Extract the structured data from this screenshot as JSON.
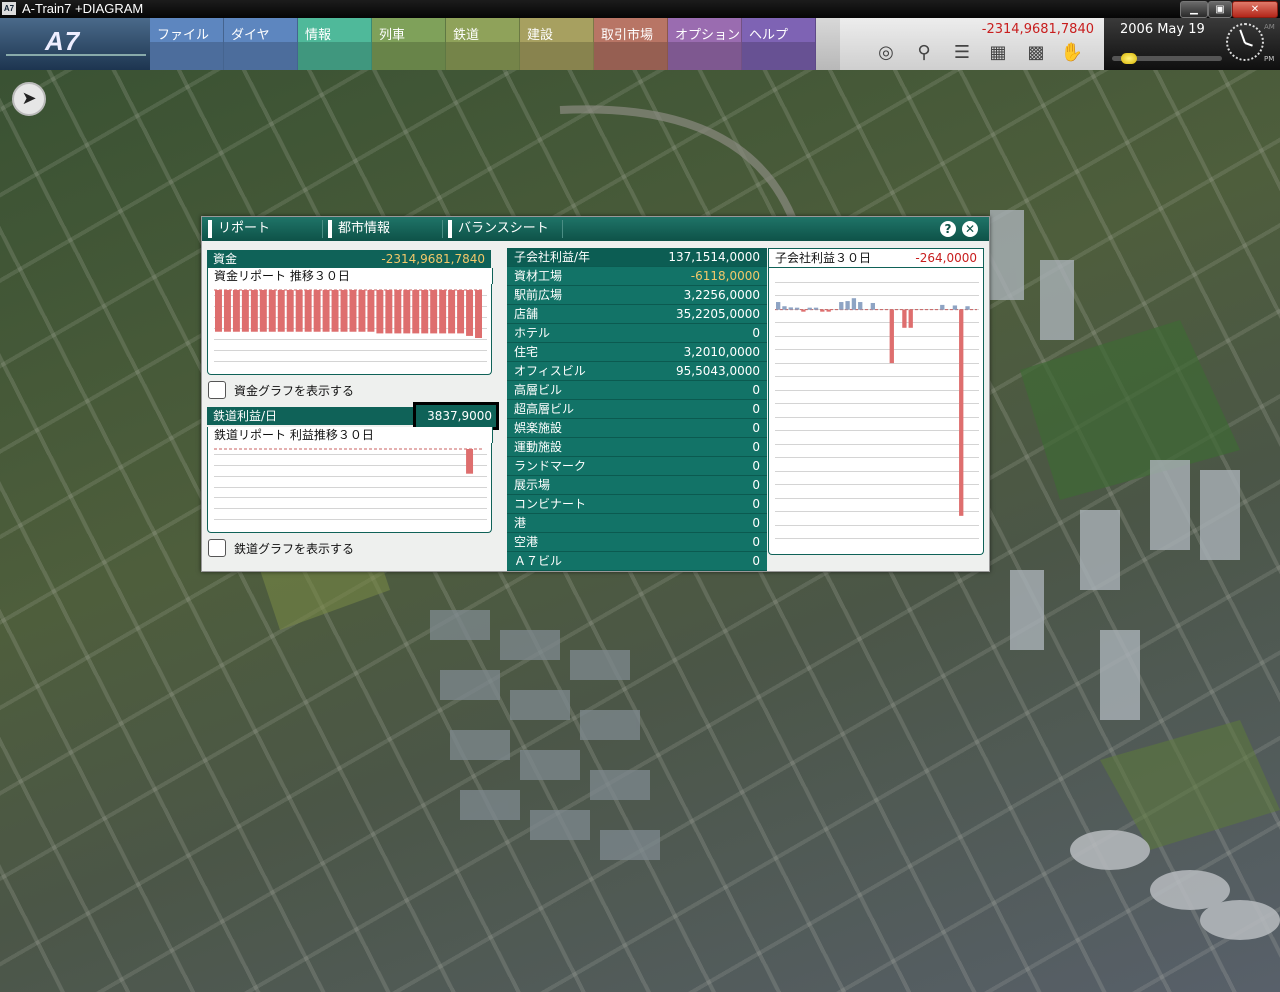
{
  "window": {
    "title": "A-Train7 +DIAGRAM",
    "app_icon": "A7"
  },
  "logo": {
    "text": "A7"
  },
  "menu": [
    {
      "label": "ファイル",
      "color": "#5d86bf"
    },
    {
      "label": "ダイヤ",
      "color": "#5d86bf"
    },
    {
      "label": "情報",
      "color": "#4fb99a"
    },
    {
      "label": "列車",
      "color": "#7fa15a"
    },
    {
      "label": "鉄道",
      "color": "#8fa25a"
    },
    {
      "label": "建設",
      "color": "#a7a060"
    },
    {
      "label": "取引市場",
      "color": "#b87565"
    },
    {
      "label": "オプション",
      "color": "#9a6cb0"
    },
    {
      "label": "ヘルプ",
      "color": "#7e63b4"
    }
  ],
  "status": {
    "funds": "-2314,9681,7840",
    "date": "2006 May 19",
    "speed_level": 0.1,
    "am_label": "AM",
    "pm_label": "PM"
  },
  "tools": [
    "planet-icon",
    "magnifier-icon",
    "layers-icon",
    "building-icon",
    "grid-icon",
    "hand-icon"
  ],
  "tabs": [
    "リポート",
    "都市情報",
    "バランスシート"
  ],
  "controls": {
    "help": "?",
    "close": "✕"
  },
  "funds_panel": {
    "label": "資金",
    "value": "-2314,9681,7840",
    "subtitle": "資金リポート 推移３０日",
    "checkbox_label": "資金グラフを表示する",
    "checked": false
  },
  "rail_panel": {
    "label": "鉄道利益/日",
    "value": "3837,9000",
    "subtitle": "鉄道リポート 利益推移３０日",
    "checkbox_label": "鉄道グラフを表示する",
    "checked": false
  },
  "subsidiaries": {
    "header": {
      "name": "子会社利益/年",
      "value": "137,1514,0000"
    },
    "rows": [
      {
        "name": "資材工場",
        "value": "-6118,0000",
        "negative": true
      },
      {
        "name": "駅前広場",
        "value": "3,2256,0000"
      },
      {
        "name": "店舗",
        "value": "35,2205,0000"
      },
      {
        "name": "ホテル",
        "value": "0"
      },
      {
        "name": "住宅",
        "value": "3,2010,0000"
      },
      {
        "name": "オフィスビル",
        "value": "95,5043,0000"
      },
      {
        "name": "高層ビル",
        "value": "0"
      },
      {
        "name": "超高層ビル",
        "value": "0"
      },
      {
        "name": "娯楽施設",
        "value": "0"
      },
      {
        "name": "運動施設",
        "value": "0"
      },
      {
        "name": "ランドマーク",
        "value": "0"
      },
      {
        "name": "展示場",
        "value": "0"
      },
      {
        "name": "コンビナート",
        "value": "0"
      },
      {
        "name": "港",
        "value": "0"
      },
      {
        "name": "空港",
        "value": "0"
      },
      {
        "name": "Ａ７ビル",
        "value": "0"
      }
    ]
  },
  "profit_panel": {
    "label": "子会社利益３０日",
    "value": "-264,0000"
  },
  "chart_data": [
    {
      "type": "bar",
      "name": "funds_30d",
      "values": [
        -1,
        -1,
        -1,
        -1,
        -1,
        -1,
        -1,
        -1,
        -1,
        -1,
        -1,
        -1,
        -1,
        -1,
        -1,
        -1,
        -1,
        -1,
        -1.04,
        -1.04,
        -1.04,
        -1.04,
        -1.04,
        -1.04,
        -1.04,
        -1.04,
        -1.04,
        -1.04,
        -1.1,
        -1.15
      ],
      "ylim": [
        -1.15,
        0
      ],
      "color": "#de6e6e"
    },
    {
      "type": "bar",
      "name": "rail_profit_30d",
      "values": [
        0,
        0,
        0,
        0,
        0,
        0,
        0,
        0,
        0,
        0,
        0,
        0,
        0,
        0,
        0,
        0,
        0,
        0,
        0,
        0,
        0,
        0,
        0,
        0,
        0,
        0,
        0,
        0,
        0.95,
        0
      ],
      "ylim": [
        0,
        1
      ],
      "color": "#de6e6e"
    },
    {
      "type": "bar",
      "name": "subsidiary_profit_30d",
      "values": [
        40,
        18,
        12,
        8,
        -5,
        5,
        10,
        -8,
        -10,
        0,
        40,
        45,
        60,
        40,
        0,
        35,
        0,
        0,
        -280,
        0,
        -95,
        -95,
        0,
        0,
        0,
        0,
        25,
        0,
        22,
        -1080,
        18,
        0
      ],
      "ylim": [
        -1100,
        100
      ],
      "pos_color": "#8ea4c4",
      "neg_color": "#de6e6e"
    }
  ]
}
